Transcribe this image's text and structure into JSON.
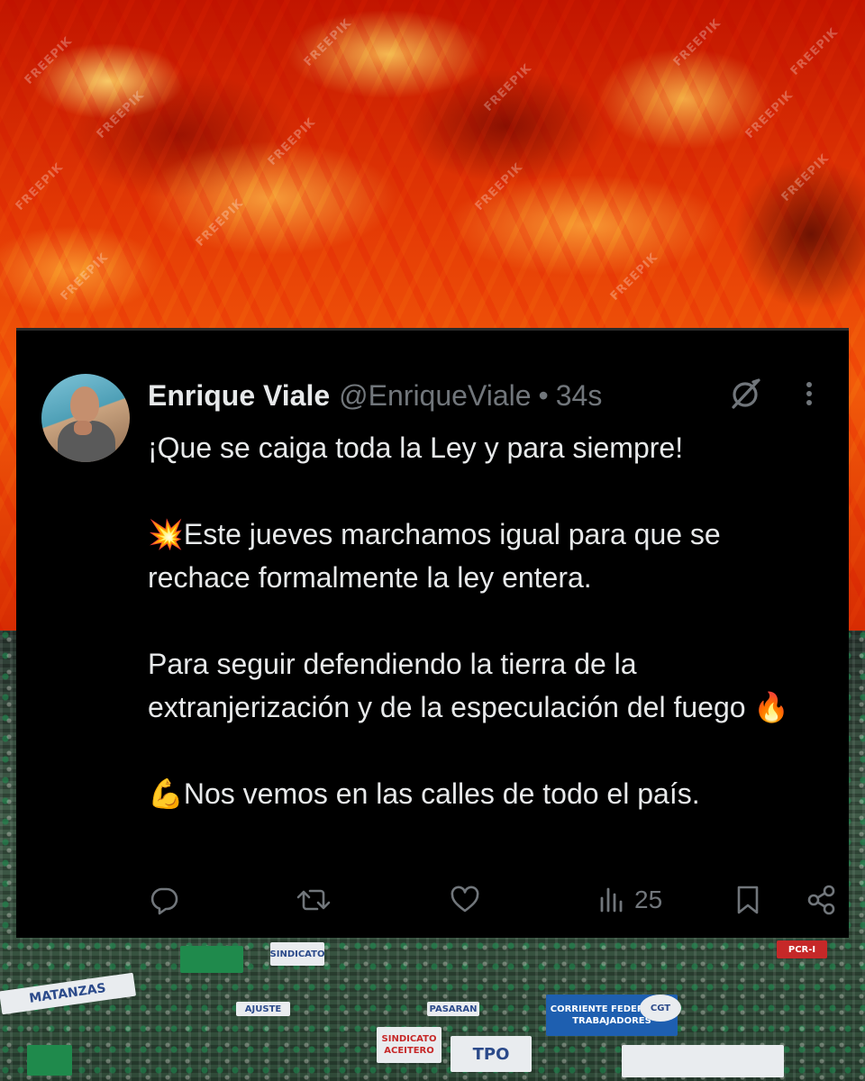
{
  "background": {
    "watermark_text": "FREEPIK",
    "banners": [
      "PCR-I",
      "CORRIENTE FEDERAL DE TRABAJADORES",
      "SINDICATO ACEITERO",
      "SINDICATO",
      "CGT",
      "TPO",
      "AJUSTE",
      "MATANZAS",
      "PASARAN"
    ]
  },
  "tweet": {
    "author": {
      "display_name": "Enrique Viale",
      "handle": "@EnriqueViale",
      "separator": "•",
      "timestamp": "34s"
    },
    "paragraphs": [
      {
        "emoji": "",
        "text": "¡Que se caiga toda la Ley y para siempre!"
      },
      {
        "emoji": "💥",
        "text": "Este jueves marchamos igual para que se rechace formalmente la ley entera."
      },
      {
        "emoji": "",
        "text": "Para seguir defendiendo la tierra de la extranjerización y de la especulación del fuego 🔥"
      },
      {
        "emoji": "💪",
        "text": "Nos vemos en las calles de todo el país."
      }
    ],
    "actions": {
      "reply_icon": "reply-icon",
      "retweet_icon": "retweet-icon",
      "like_icon": "like-icon",
      "views_icon": "views-icon",
      "views_count": "25",
      "bookmark_icon": "bookmark-icon",
      "share_icon": "share-icon"
    },
    "colors": {
      "card_bg": "#000000",
      "primary_text": "#e7e9ea",
      "secondary_text": "#71767b"
    }
  }
}
